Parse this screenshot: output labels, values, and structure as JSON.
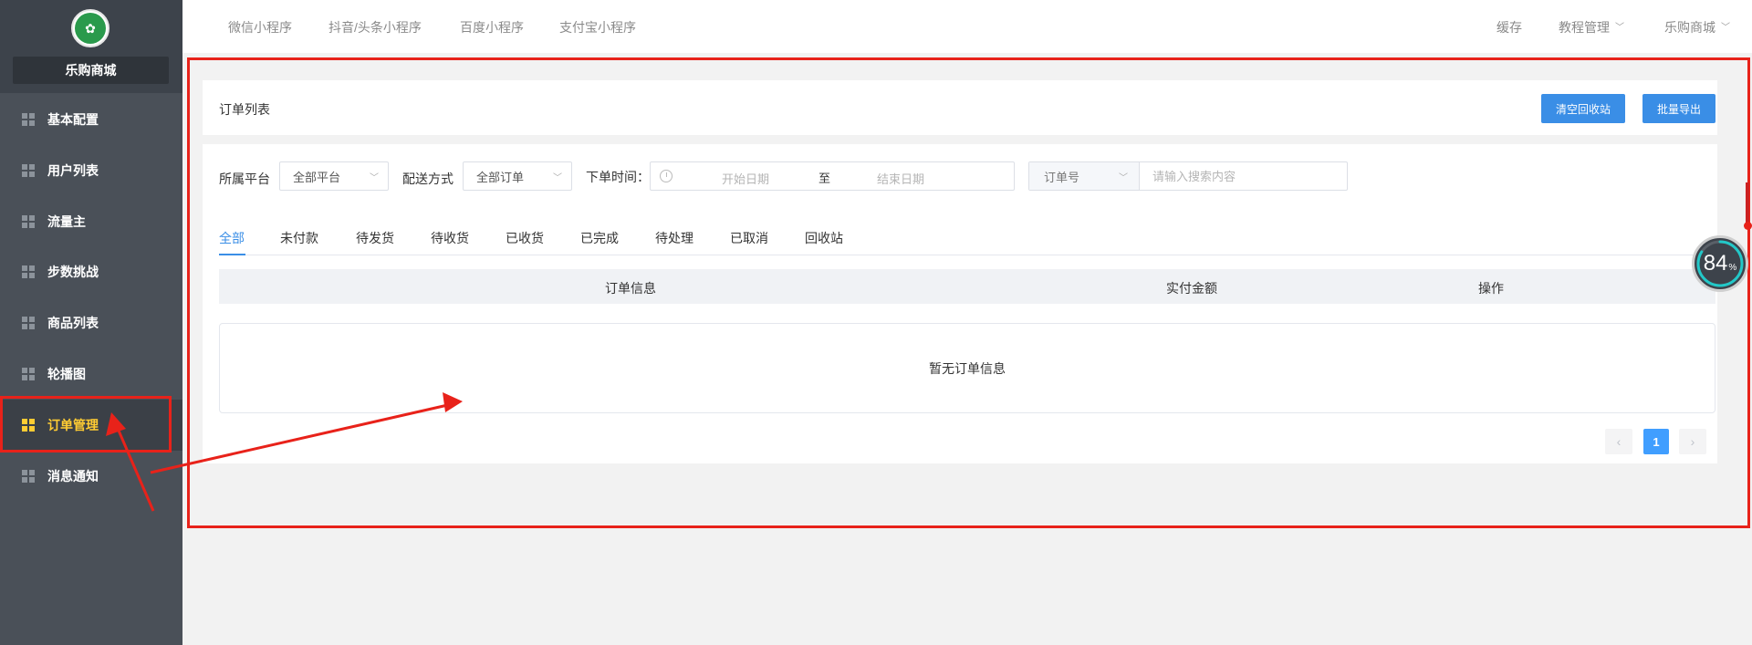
{
  "sidebar": {
    "shop_name": "乐购商城",
    "logo_glyph": "✿",
    "items": [
      {
        "label": "基本配置"
      },
      {
        "label": "用户列表"
      },
      {
        "label": "流量主"
      },
      {
        "label": "步数挑战"
      },
      {
        "label": "商品列表"
      },
      {
        "label": "轮播图"
      },
      {
        "label": "订单管理",
        "active": true
      },
      {
        "label": "消息通知"
      }
    ]
  },
  "topnav": {
    "tabs": [
      "微信小程序",
      "抖音/头条小程序",
      "百度小程序",
      "支付宝小程序"
    ],
    "cache": "缓存",
    "tutorial": "教程管理",
    "store": "乐购商城"
  },
  "order_list": {
    "title": "订单列表",
    "clear_recycle_label": "清空回收站",
    "batch_export_label": "批量导出"
  },
  "filters": {
    "platform_label": "所属平台",
    "platform_value": "全部平台",
    "delivery_label": "配送方式",
    "delivery_value": "全部订单",
    "time_label": "下单时间：",
    "start_placeholder": "开始日期",
    "range_sep": "至",
    "end_placeholder": "结束日期",
    "search_type": "订单号",
    "search_placeholder": "请输入搜索内容"
  },
  "status_tabs": [
    "全部",
    "未付款",
    "待发货",
    "待收货",
    "已收货",
    "已完成",
    "待处理",
    "已取消",
    "回收站"
  ],
  "table": {
    "columns": [
      "订单信息",
      "实付金额",
      "操作"
    ],
    "empty_text": "暂无订单信息"
  },
  "pagination": {
    "prev": "‹",
    "current_page": "1",
    "next": "›"
  },
  "gauge": {
    "value": "84",
    "unit": "%"
  },
  "colors": {
    "accent": "#3a8ee6",
    "annotation": "#e8221a",
    "active_menu": "#ffcc33"
  }
}
